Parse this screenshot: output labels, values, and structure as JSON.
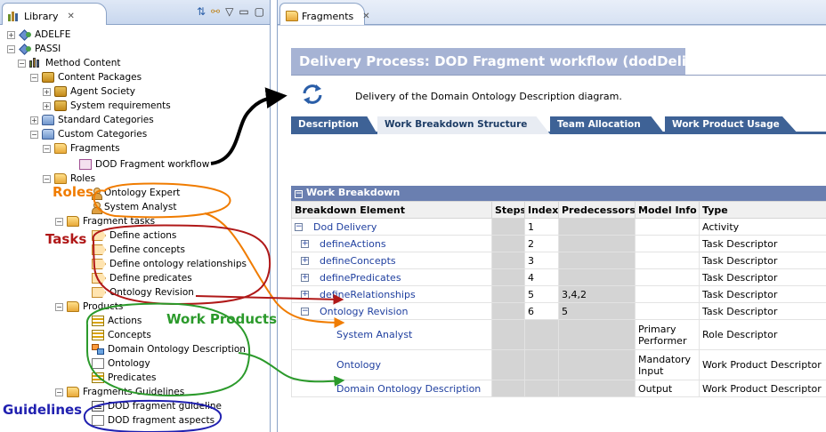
{
  "library_panel": {
    "tab_title": "Library",
    "tree": [
      {
        "label": "ADELFE",
        "toggle": "+",
        "icon": "method-plugin-icon"
      },
      {
        "label": "PASSI",
        "toggle": "−",
        "icon": "method-plugin-icon"
      },
      {
        "label": "Method Content",
        "toggle": "−",
        "icon": "method-content-icon"
      },
      {
        "label": "Content Packages",
        "toggle": "−",
        "icon": "content-package-icon"
      },
      {
        "label": "Agent Society",
        "toggle": "+",
        "icon": "content-package-icon"
      },
      {
        "label": "System requirements",
        "toggle": "+",
        "icon": "content-package-icon"
      },
      {
        "label": "Standard Categories",
        "toggle": "+",
        "icon": "category-icon"
      },
      {
        "label": "Custom Categories",
        "toggle": "−",
        "icon": "category-icon"
      },
      {
        "label": "Fragments",
        "toggle": "−",
        "icon": "folder-icon"
      },
      {
        "label": "DOD Fragment workflow",
        "toggle": "",
        "icon": "workflow-icon"
      },
      {
        "label": "Roles",
        "toggle": "−",
        "icon": "folder-icon"
      },
      {
        "label": "Ontology Expert",
        "toggle": "",
        "icon": "role-icon"
      },
      {
        "label": "System Analyst",
        "toggle": "",
        "icon": "role-icon"
      },
      {
        "label": "Fragment tasks",
        "toggle": "−",
        "icon": "folder-icon"
      },
      {
        "label": "Define actions",
        "toggle": "",
        "icon": "task-icon"
      },
      {
        "label": "Define concepts",
        "toggle": "",
        "icon": "task-icon"
      },
      {
        "label": "Define ontology relationships",
        "toggle": "",
        "icon": "task-icon"
      },
      {
        "label": "Define predicates",
        "toggle": "",
        "icon": "task-icon"
      },
      {
        "label": "Ontology Revision",
        "toggle": "",
        "icon": "task-icon"
      },
      {
        "label": "Products",
        "toggle": "−",
        "icon": "folder-icon"
      },
      {
        "label": "Actions",
        "toggle": "",
        "icon": "work-product-icon"
      },
      {
        "label": "Concepts",
        "toggle": "",
        "icon": "work-product-icon"
      },
      {
        "label": "Domain Ontology Description",
        "toggle": "",
        "icon": "diagram-icon"
      },
      {
        "label": "Ontology",
        "toggle": "",
        "icon": "document-icon"
      },
      {
        "label": "Predicates",
        "toggle": "",
        "icon": "work-product-icon"
      },
      {
        "label": "Fragments Guidelines",
        "toggle": "−",
        "icon": "folder-icon"
      },
      {
        "label": "DOD fragment guideline",
        "toggle": "",
        "icon": "guideline-icon"
      },
      {
        "label": "DOD fragment aspects",
        "toggle": "",
        "icon": "document-icon"
      }
    ]
  },
  "fragments_panel": {
    "tab_title": "Fragments",
    "process_title": "Delivery Process: DOD Fragment workflow (dodDelivery)",
    "description": "Delivery of the Domain Ontology Description diagram.",
    "tabs": [
      "Description",
      "Work Breakdown Structure",
      "Team Allocation",
      "Work Product Usage"
    ],
    "active_tab": "Work Breakdown Structure",
    "section_title": "Work Breakdown",
    "columns": [
      "Breakdown Element",
      "Steps",
      "Index",
      "Predecessors",
      "Model Info",
      "Type"
    ],
    "rows": [
      {
        "element": "Dod Delivery",
        "toggle": "−",
        "steps": "",
        "index": "1",
        "predecessors": "",
        "model_info": "",
        "type": "Activity"
      },
      {
        "element": "defineActions",
        "toggle": "+",
        "steps": "",
        "index": "2",
        "predecessors": "",
        "model_info": "",
        "type": "Task Descriptor"
      },
      {
        "element": "defineConcepts",
        "toggle": "+",
        "steps": "",
        "index": "3",
        "predecessors": "",
        "model_info": "",
        "type": "Task Descriptor"
      },
      {
        "element": "definePredicates",
        "toggle": "+",
        "steps": "",
        "index": "4",
        "predecessors": "",
        "model_info": "",
        "type": "Task Descriptor"
      },
      {
        "element": "defineRelationships",
        "toggle": "+",
        "steps": "",
        "index": "5",
        "predecessors": "3,4,2",
        "model_info": "",
        "type": "Task Descriptor"
      },
      {
        "element": "Ontology Revision",
        "toggle": "−",
        "steps": "",
        "index": "6",
        "predecessors": "5",
        "model_info": "",
        "type": "Task Descriptor"
      },
      {
        "element": "System Analyst",
        "toggle": "",
        "steps": "",
        "index": "",
        "predecessors": "",
        "model_info": "Primary Performer",
        "type": "Role Descriptor"
      },
      {
        "element": "Ontology",
        "toggle": "",
        "steps": "",
        "index": "",
        "predecessors": "",
        "model_info": "Mandatory Input",
        "type": "Work Product Descriptor"
      },
      {
        "element": "Domain Ontology Description",
        "toggle": "",
        "steps": "",
        "index": "",
        "predecessors": "",
        "model_info": "Output",
        "type": "Work Product Descriptor"
      }
    ]
  },
  "annotations": {
    "roles": "Roles",
    "tasks": "Tasks",
    "work_products": "Work Products",
    "guidelines": "Guidelines",
    "colors": {
      "roles": "#f07c00",
      "tasks": "#b01818",
      "work_products": "#2b9a2b",
      "guidelines": "#2020b0"
    }
  }
}
